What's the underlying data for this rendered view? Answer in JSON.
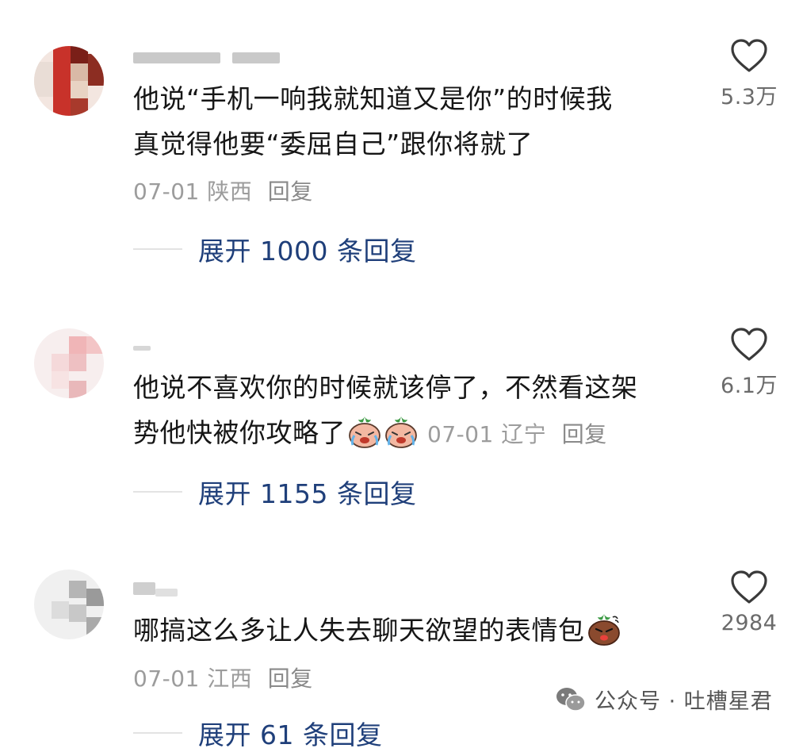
{
  "comments": [
    {
      "text_line1": "他说“手机一响我就知道又是你”的时候我",
      "text_line2": "真觉得他要“委屈自己”跟你将就了",
      "date": "07-01",
      "location": "陕西",
      "reply_label": "回复",
      "likes": "5.3万",
      "expand_label": "展开 1000 条回复"
    },
    {
      "text_line1": "他说不喜欢你的时候就该停了，不然看这架",
      "text_line2": "势他快被你攻略了",
      "date": "07-01",
      "location": "辽宁",
      "reply_label": "回复",
      "likes": "6.1万",
      "expand_label": "展开 1155 条回复",
      "emojis": [
        "crying-face-emoji",
        "crying-face-emoji"
      ]
    },
    {
      "text_line1": "哪搞这么多让人失去聊天欲望的表情包",
      "date": "07-01",
      "location": "江西",
      "reply_label": "回复",
      "likes": "2984",
      "expand_label": "展开 61 条回复",
      "emojis": [
        "angry-face-emoji"
      ]
    }
  ],
  "watermark": {
    "text": "公众号 · 吐槽星君",
    "icon": "wechat-icon"
  }
}
